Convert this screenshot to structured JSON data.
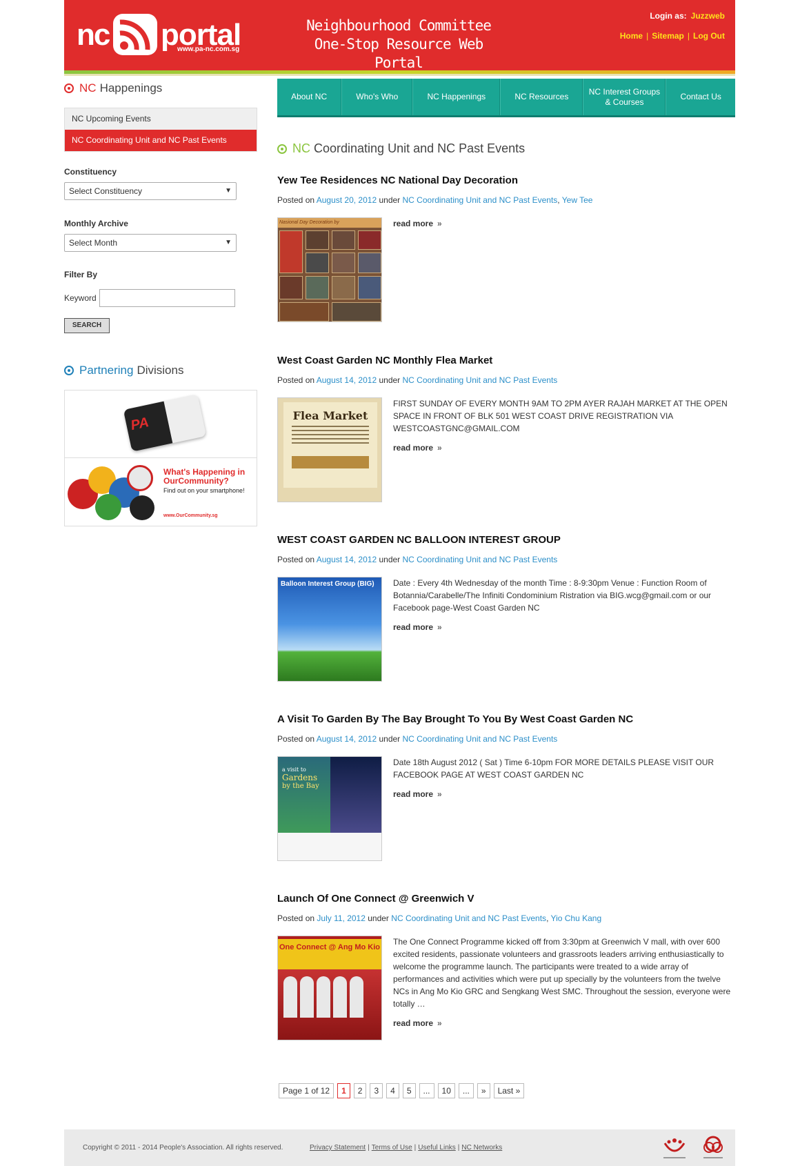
{
  "header": {
    "logo_nc": "nc",
    "logo_portal": "portal",
    "logo_url": "www.pa-nc.com.sg",
    "tagline_line1": "Neighbourhood Committee",
    "tagline_line2": "One-Stop Resource Web Portal",
    "login_label": "Login as:",
    "login_user": "Juzzweb",
    "links": {
      "home": "Home",
      "sitemap": "Sitemap",
      "logout": "Log Out"
    }
  },
  "nav": {
    "items": [
      "About NC",
      "Who's Who",
      "NC Happenings",
      "NC Resources",
      "NC Interest Groups & Courses",
      "Contact Us"
    ]
  },
  "sidebar": {
    "happenings_hl": "NC",
    "happenings_title": "Happenings",
    "menu": [
      "NC Upcoming Events",
      "NC Coordinating Unit and NC Past Events"
    ],
    "constituency_label": "Constituency",
    "constituency_value": "Select Constituency",
    "archive_label": "Monthly Archive",
    "archive_value": "Select Month",
    "filter_label": "Filter By",
    "keyword_label": "Keyword",
    "keyword_value": "",
    "search_label": "SEARCH",
    "partnering_hl": "Partnering",
    "partnering_title": "Divisions",
    "partner2_line1": "What's Happening in",
    "partner2_line2": "OurCommunity?",
    "partner2_line3": "Find out on your smartphone!",
    "partner2_line4": "www.OurCommunity.sg"
  },
  "main": {
    "heading_hl": "NC",
    "heading_title": "Coordinating Unit and NC Past Events",
    "posted_on": "Posted on",
    "under": "under",
    "read_more": "read more",
    "posts": [
      {
        "title": "Yew Tee Residences NC National Day Decoration",
        "date": "August 20, 2012",
        "category": "NC Coordinating Unit and NC Past Events",
        "category2": "Yew Tee",
        "excerpt": ""
      },
      {
        "title": "West Coast Garden NC Monthly Flea Market",
        "date": "August 14, 2012",
        "category": "NC Coordinating Unit and NC Past Events",
        "category2": "",
        "excerpt": "FIRST SUNDAY OF EVERY MONTH 9AM TO 2PM AYER RAJAH MARKET AT THE OPEN SPACE IN FRONT OF BLK 501 WEST COAST DRIVE REGISTRATION VIA WESTCOASTGNC@GMAIL.COM"
      },
      {
        "title": "WEST COAST GARDEN NC BALLOON INTEREST GROUP",
        "date": "August 14, 2012",
        "category": "NC Coordinating Unit and NC Past Events",
        "category2": "",
        "excerpt": "Date : Every 4th Wednesday of the month Time : 8-9:30pm Venue : Function Room of Botannia/Carabelle/The Infiniti Condominium Ristration via BIG.wcg@gmail.com or our Facebook page-West Coast Garden NC"
      },
      {
        "title": "A Visit To Garden By The Bay Brought To You By West Coast Garden NC",
        "date": "August 14, 2012",
        "category": "NC Coordinating Unit and NC Past Events",
        "category2": "",
        "excerpt": "Date 18th August 2012 ( Sat ) Time 6-10pm FOR MORE DETAILS PLEASE VISIT OUR FACEBOOK PAGE AT WEST COAST GARDEN NC"
      },
      {
        "title": "Launch Of One Connect @ Greenwich V",
        "date": "July 11, 2012",
        "category": "NC Coordinating Unit and NC Past Events",
        "category2": "Yio Chu Kang",
        "excerpt": "The One Connect Programme kicked off from 3:30pm at Greenwich V mall, with over 600 excited residents, passionate volunteers and grassroots leaders arriving enthusiastically to welcome the programme launch. The participants were treated to a wide array of performances and activities which were put up specially by the volunteers from the twelve NCs in Ang Mo Kio GRC and Sengkang West SMC. Throughout the session, everyone were totally …"
      }
    ],
    "thumb_texts": {
      "t1": "Nasional Day Decoration by",
      "t2": "Flea Market",
      "t3": "Balloon Interest Group (BIG)",
      "t4a": "a visit to",
      "t4b": "Gardens",
      "t4c": "by the Bay",
      "t5": "One Connect @ Ang Mo Kio"
    }
  },
  "pagination": {
    "summary": "Page 1 of 12",
    "pages": [
      "1",
      "2",
      "3",
      "4",
      "5",
      "...",
      "10",
      "...",
      "»",
      "Last »"
    ],
    "current": "1"
  },
  "footer": {
    "copyright": "Copyright © 2011 - 2014 People's Association. All rights reserved.",
    "links": [
      "Privacy Statement",
      "Terms of Use",
      "Useful Links",
      "NC Networks"
    ]
  },
  "colors": {
    "brand_red": "#e02c2c",
    "nav_teal": "#1aa694",
    "link_blue": "#2c8fc9",
    "accent_green": "#8bc53f",
    "yellow": "#ffe11a"
  }
}
